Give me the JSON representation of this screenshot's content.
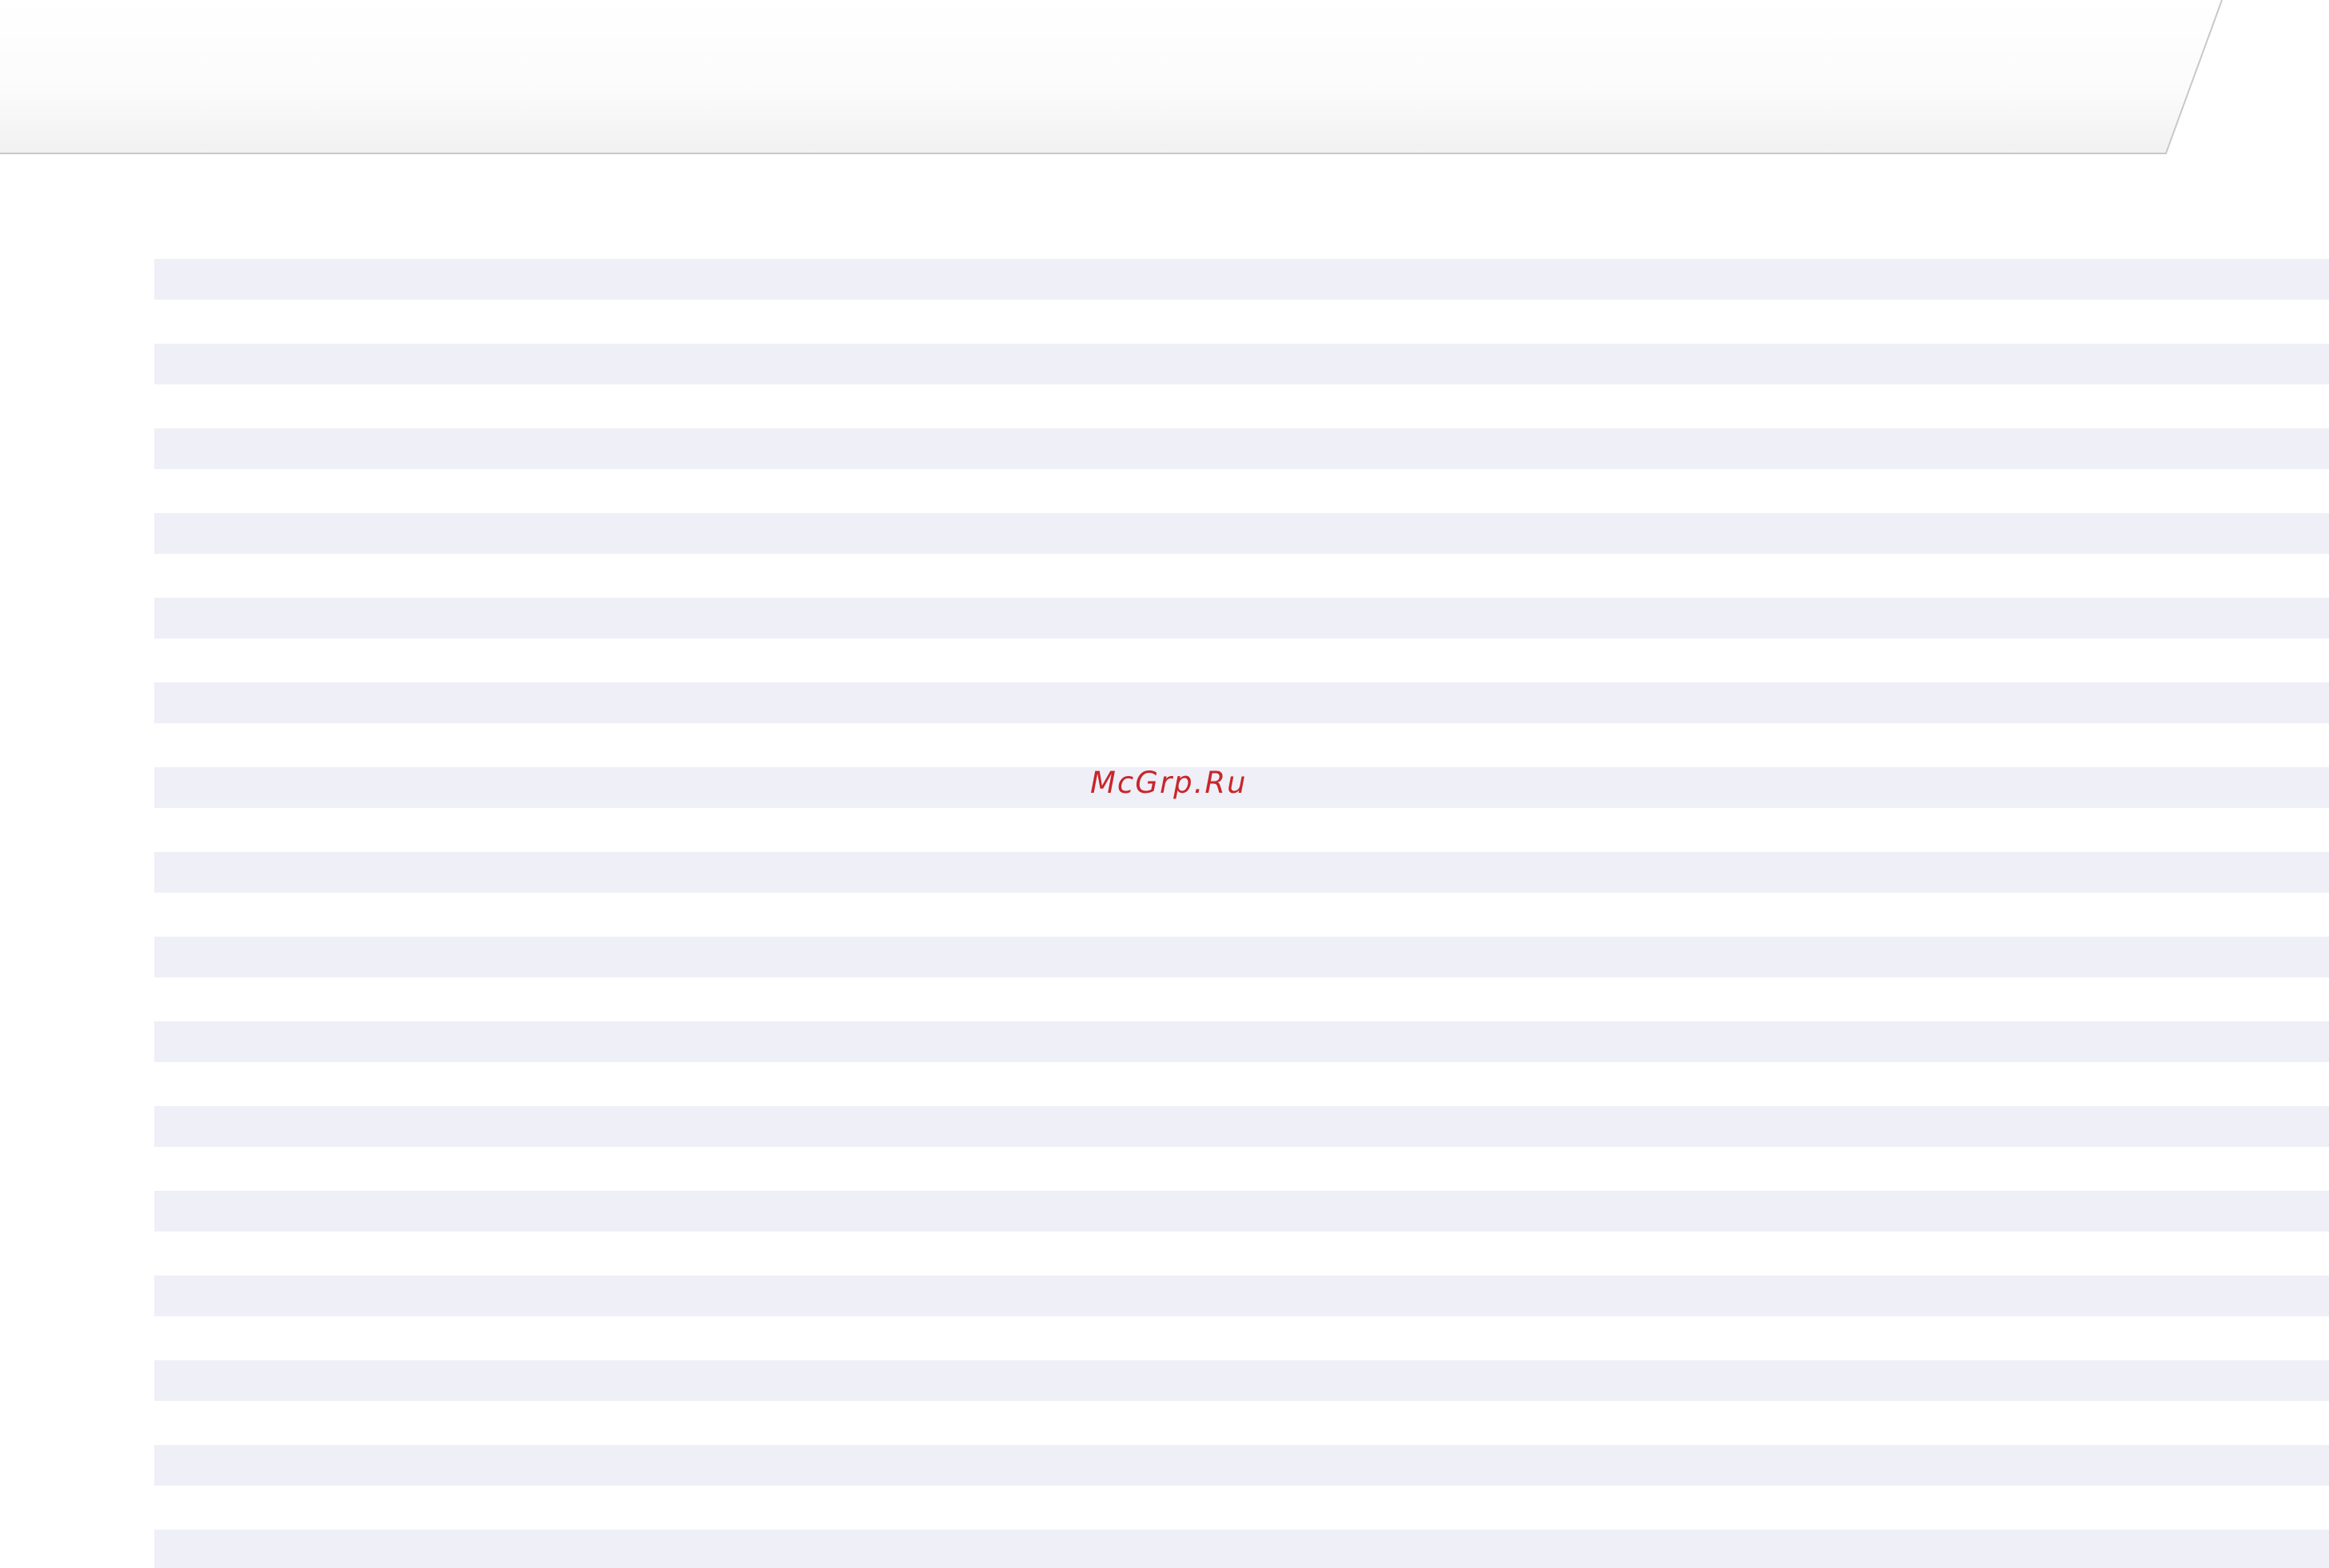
{
  "watermark": {
    "text": "McGrp.Ru",
    "color": "#c8262a"
  },
  "page": {
    "header_band_color_top": "#ffffff",
    "header_band_color_bottom": "#f1f1f1",
    "header_border_color": "#c8c8c8",
    "stripe_color": "#efeff7",
    "stripe_count": 16
  }
}
